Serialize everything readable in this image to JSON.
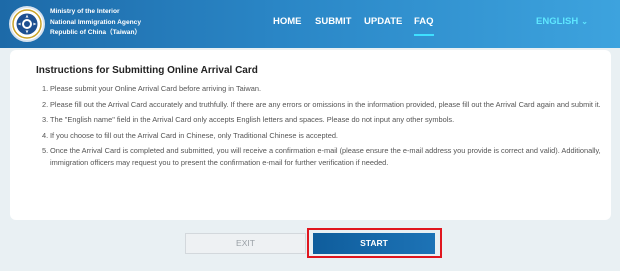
{
  "header": {
    "agency_lines": [
      "Ministry of the Interior",
      "National Immigration Agency",
      "Republic of China（Taiwan）"
    ],
    "nav": [
      {
        "label": "HOME",
        "active": false
      },
      {
        "label": "SUBMIT",
        "active": false
      },
      {
        "label": "UPDATE",
        "active": false
      },
      {
        "label": "FAQ",
        "active": true
      }
    ],
    "language": "ENGLISH",
    "language_icon": "chevron-down-icon",
    "logo_icon": "agency-emblem-icon"
  },
  "instructions": {
    "title": "Instructions for Submitting Online Arrival Card",
    "items": [
      {
        "num": "1.",
        "text": "Please submit your Online Arrival Card before arriving in Taiwan."
      },
      {
        "num": "2.",
        "text": "Please fill out the Arrival Card accurately and truthfully. If there are any errors or omissions in the information provided, please fill out the Arrival Card again and submit it."
      },
      {
        "num": "3.",
        "text": "The \"English name\" field in the Arrival Card only accepts English letters and spaces. Please do not input any other symbols."
      },
      {
        "num": "4.",
        "text": "If you choose to fill out the Arrival Card in Chinese, only Traditional Chinese is accepted."
      },
      {
        "num": "5.",
        "text": "Once the Arrival Card is completed and submitted, you will receive a confirmation e-mail (please ensure the e-mail address you provide is correct and valid). Additionally, immigration officers may request you to present the confirmation e-mail for further verification if needed."
      }
    ]
  },
  "actions": {
    "exit_label": "EXIT",
    "start_label": "START"
  },
  "colors": {
    "header_start": "#1d6aa8",
    "header_end": "#3da3de",
    "accent": "#5ee6ff",
    "start_button": "#1569ab",
    "highlight": "#e0161e"
  }
}
